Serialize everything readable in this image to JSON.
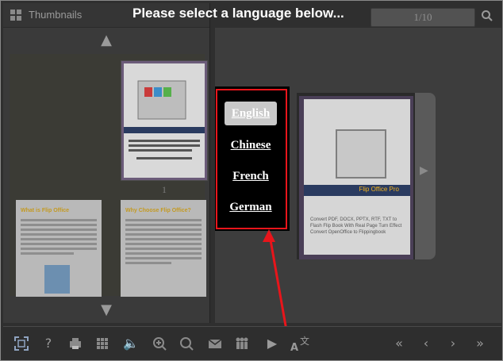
{
  "sidebar": {
    "title": "Thumbnails",
    "current_page_label": "1",
    "page_a_heading": "What is Flip Office",
    "page_b_heading": "Why Choose Flip Office?"
  },
  "header": {
    "page_counter": "1/10",
    "prompt": "Please select a language below..."
  },
  "language_menu": {
    "items": [
      "English",
      "Chinese",
      "French",
      "German"
    ],
    "selected": "English"
  },
  "book_page": {
    "brand": "Flip Office Pro",
    "text": "Convert PDF, DOCX, PPTX, RTF, TXT to Flash Flip Book With Real Page Turn Effect Convert OpenOffice to Flippingbook"
  },
  "colors": {
    "highlight_red": "#e8151b",
    "brand_gold": "#f2b21c",
    "selected_bg": "#c9c9c9"
  },
  "toolbar_icons": [
    "fullscreen-icon",
    "help-icon",
    "print-icon",
    "thumbnails-icon",
    "sound-icon",
    "zoom-in-icon",
    "zoom-out-icon",
    "email-icon",
    "share-icon",
    "autoplay-icon",
    "language-icon",
    "first-page-icon",
    "previous-page-icon",
    "next-page-icon",
    "last-page-icon"
  ]
}
